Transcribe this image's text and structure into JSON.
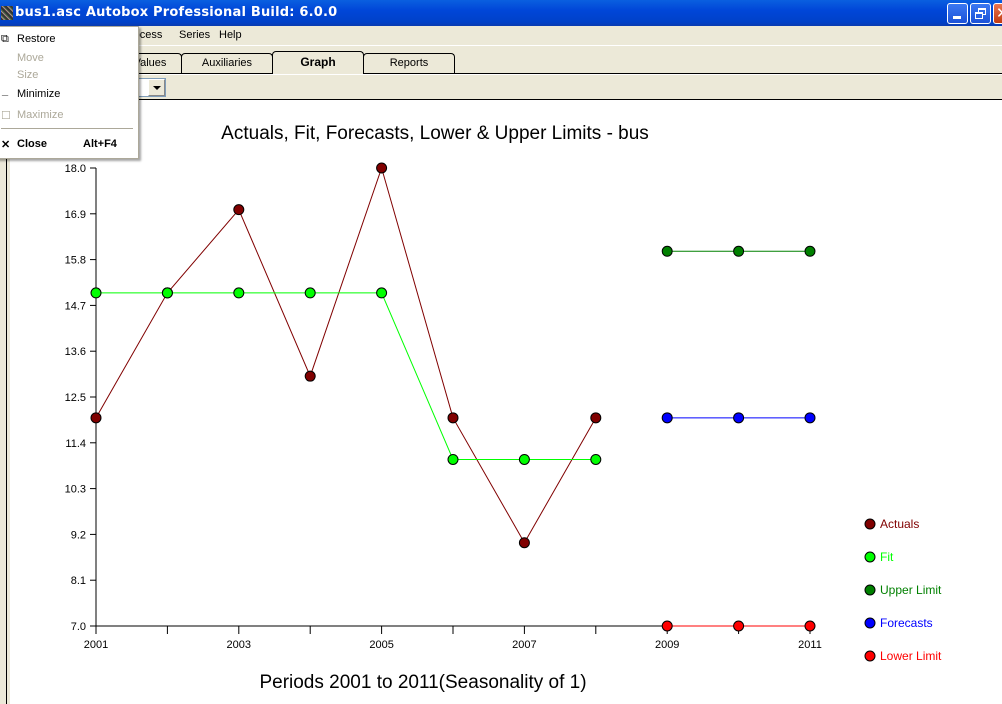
{
  "window": {
    "title": "bus1.asc  Autobox Professional Build: 6.0.0",
    "buttons": {
      "minimize": "minimize",
      "restore": "restore",
      "close": "close"
    }
  },
  "menubar": {
    "items": [
      "Process",
      "Series",
      "Help"
    ],
    "partial_first_visible": "rocess"
  },
  "tabs": [
    {
      "label": "Values",
      "active": false
    },
    {
      "label": "Auxiliaries",
      "active": false
    },
    {
      "label": "Graph",
      "active": true
    },
    {
      "label": "Reports",
      "active": false
    }
  ],
  "system_menu": {
    "items": [
      {
        "label": "Restore",
        "enabled": true,
        "icon": "restore-icon"
      },
      {
        "label": "Move",
        "enabled": false
      },
      {
        "label": "Size",
        "enabled": false
      },
      {
        "label": "Minimize",
        "enabled": true,
        "icon": "minimize-icon"
      },
      {
        "label": "Maximize",
        "enabled": false,
        "icon": "maximize-icon"
      },
      {
        "label": "Close",
        "enabled": true,
        "icon": "close-icon",
        "shortcut": "Alt+F4"
      }
    ]
  },
  "chart_data": {
    "type": "line",
    "title": "Actuals, Fit, Forecasts, Lower & Upper Limits - bus",
    "xlabel": "Periods 2001 to 2011(Seasonality of 1)",
    "ylabel": "",
    "x": [
      2001,
      2002,
      2003,
      2004,
      2005,
      2006,
      2007,
      2008,
      2009,
      2010,
      2011
    ],
    "xtick_labels": [
      "2001",
      "2003",
      "2005",
      "2007",
      "2009",
      "2011"
    ],
    "xlim": [
      2001,
      2011
    ],
    "ylim": [
      7.0,
      18.0
    ],
    "ytick_labels": [
      "7.0",
      "8.1",
      "9.2",
      "10.3",
      "11.4",
      "12.5",
      "13.6",
      "14.7",
      "15.8",
      "16.9",
      "18.0"
    ],
    "grid": false,
    "legend_position": "bottom-right",
    "series": [
      {
        "name": "Actuals",
        "color": "#800000",
        "x": [
          2001,
          2002,
          2003,
          2004,
          2005,
          2006,
          2007,
          2008
        ],
        "values": [
          12,
          15,
          17,
          13,
          18,
          12,
          9,
          12
        ]
      },
      {
        "name": "Fit",
        "color": "#00ff00",
        "x": [
          2001,
          2002,
          2003,
          2004,
          2005,
          2006,
          2007,
          2008
        ],
        "values": [
          15,
          15,
          15,
          15,
          15,
          11,
          11,
          11
        ]
      },
      {
        "name": "Upper Limit",
        "color": "#008000",
        "x": [
          2009,
          2010,
          2011
        ],
        "values": [
          16,
          16,
          16
        ]
      },
      {
        "name": "Forecasts",
        "color": "#0000ff",
        "x": [
          2009,
          2010,
          2011
        ],
        "values": [
          12,
          12,
          12
        ]
      },
      {
        "name": "Lower Limit",
        "color": "#ff0000",
        "x": [
          2009,
          2010,
          2011
        ],
        "values": [
          7,
          7,
          7
        ]
      }
    ]
  }
}
